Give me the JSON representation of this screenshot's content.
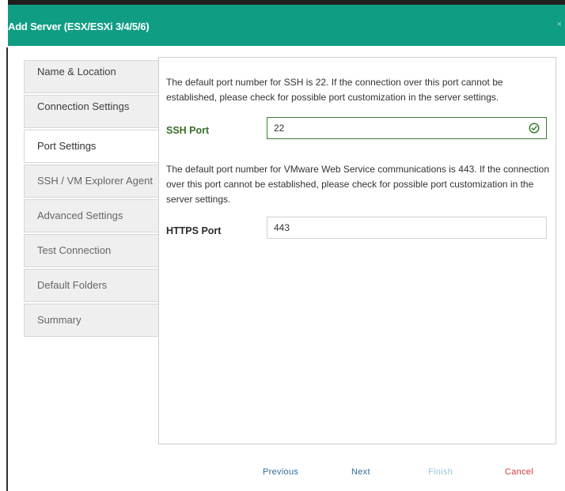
{
  "dialog": {
    "title": "Add Server (ESX/ESXi 3/4/5/6)",
    "close_glyph": "×"
  },
  "nav": {
    "items": [
      {
        "label": "Name & Location",
        "state": "done"
      },
      {
        "label": "Connection Settings",
        "state": "done"
      },
      {
        "label": "Port Settings",
        "state": "active"
      },
      {
        "label": "SSH / VM Explorer Agent",
        "state": "pending"
      },
      {
        "label": "Advanced Settings",
        "state": "pending"
      },
      {
        "label": "Test Connection",
        "state": "pending"
      },
      {
        "label": "Default Folders",
        "state": "pending"
      },
      {
        "label": "Summary",
        "state": "pending"
      }
    ]
  },
  "port_settings": {
    "ssh_description": "The default port number for SSH is 22. If the connection over this port cannot be established, please check for possible port customization in the server settings.",
    "ssh_label": "SSH Port",
    "ssh_value": "22",
    "https_description": "The default port number for VMware Web Service communications is 443. If the connection over this port cannot be established, please check for possible port customization in the server settings.",
    "https_label": "HTTPS Port",
    "https_value": "443"
  },
  "footer": {
    "previous": "Previous",
    "next": "Next",
    "finish": "Finish",
    "cancel": "Cancel"
  },
  "colors": {
    "header": "#0f9d84",
    "valid": "#3b7d2d",
    "link": "#2f6e9d",
    "cancel": "#cf3b3b"
  },
  "icons": {
    "valid_indicator": "check-circle-icon"
  }
}
